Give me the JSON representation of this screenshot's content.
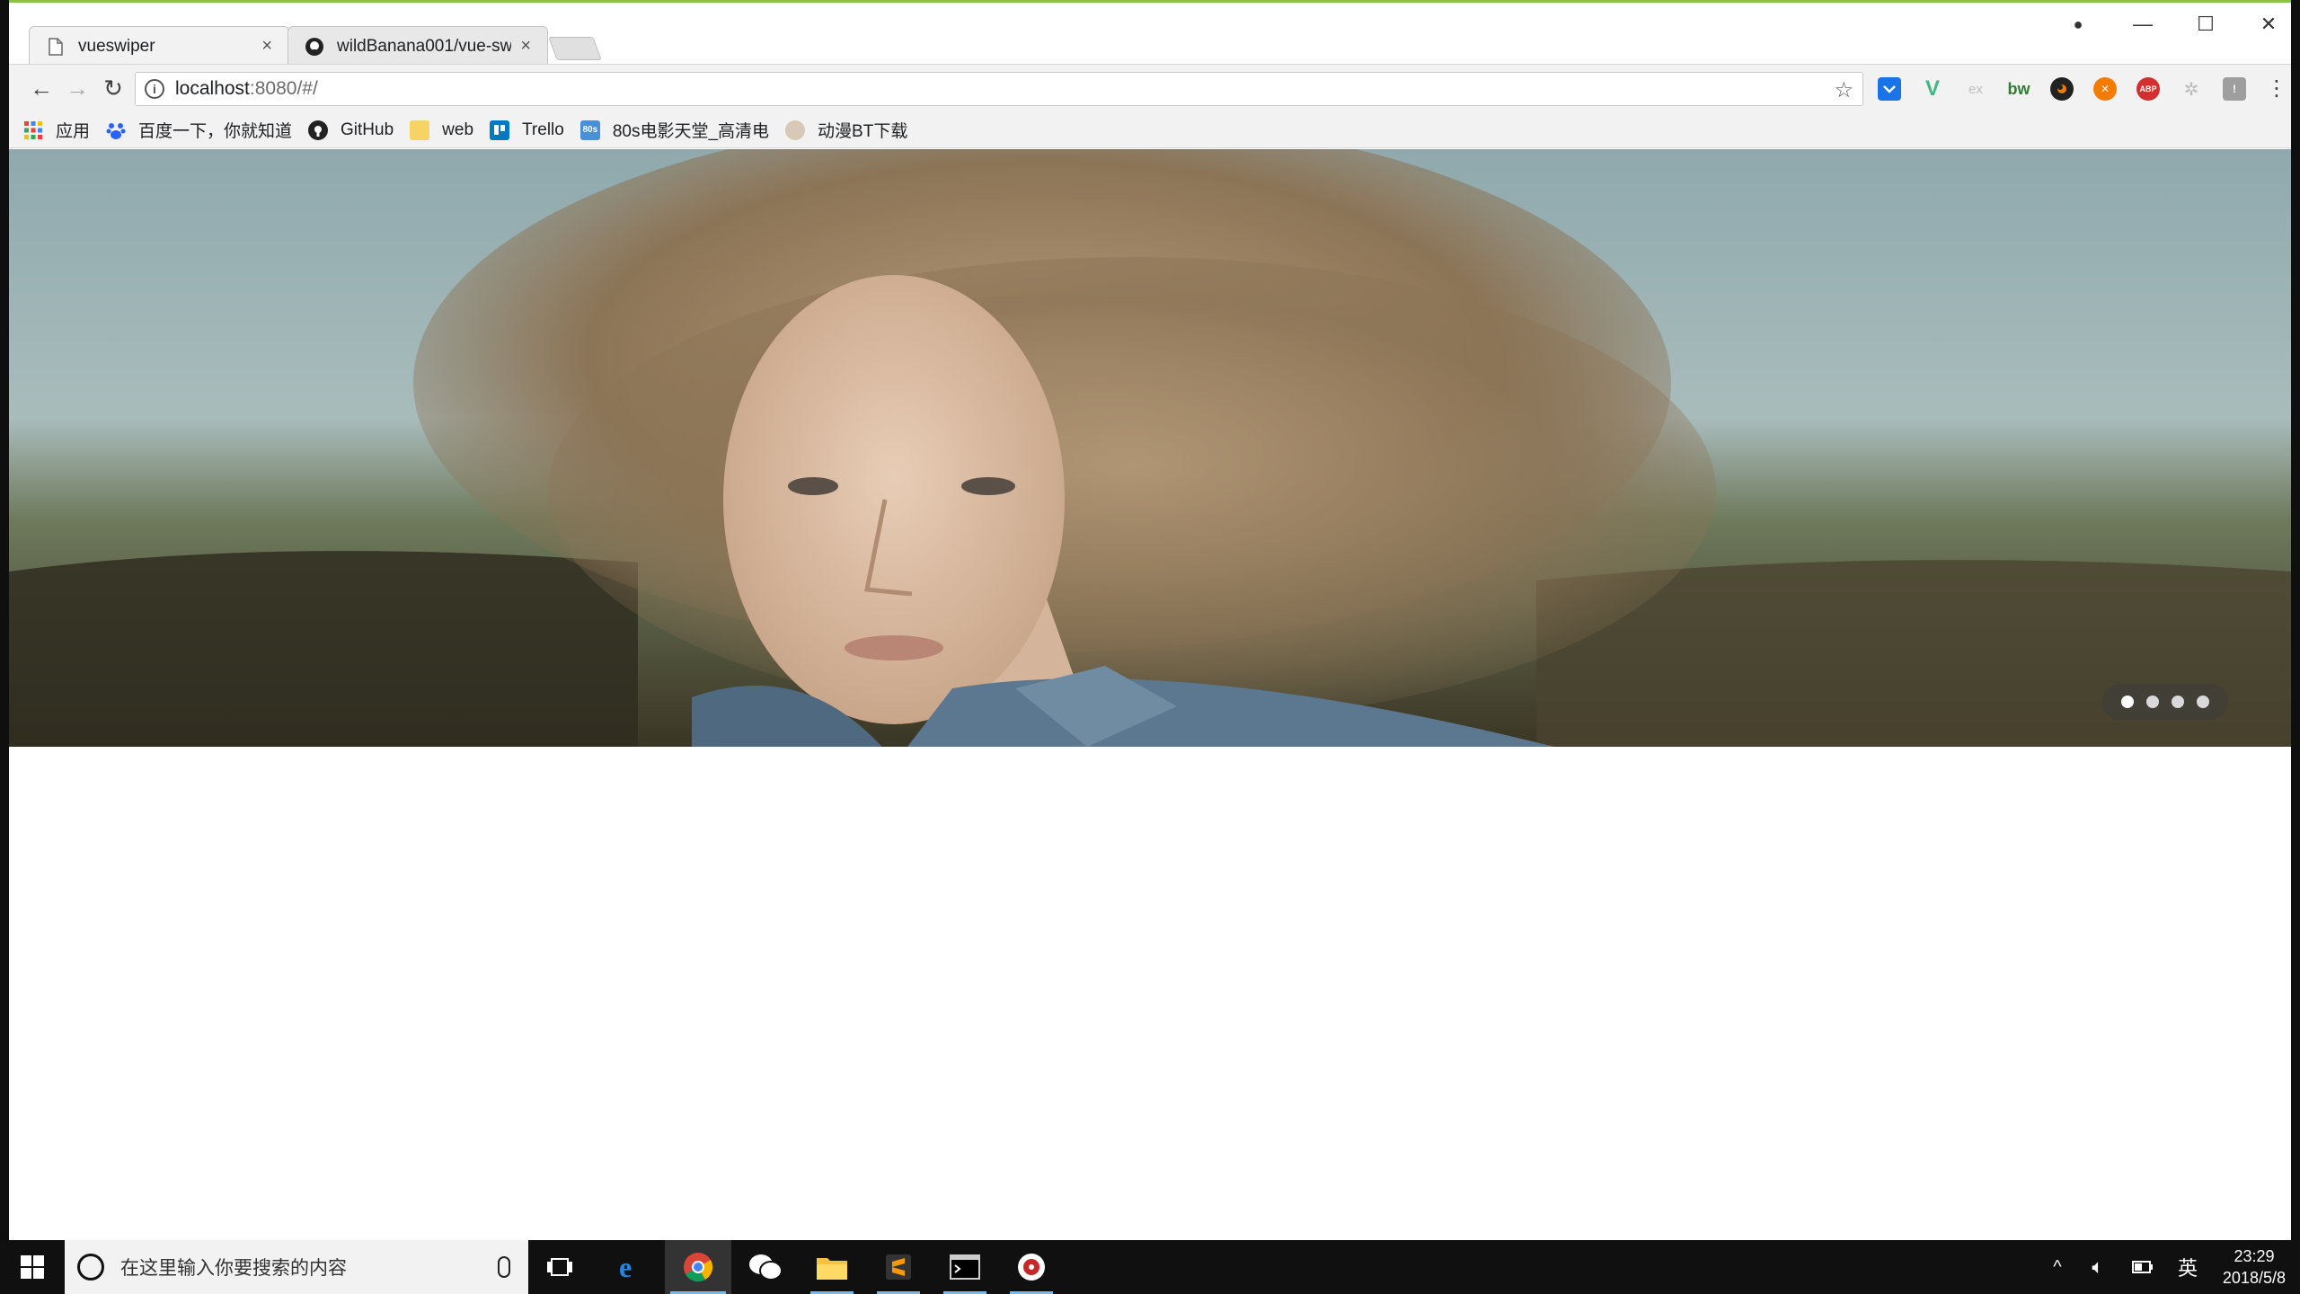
{
  "browser": {
    "tabs": [
      {
        "title": "vueswiper",
        "active": true
      },
      {
        "title": "wildBanana001/vue-sw",
        "active": false
      }
    ],
    "close_glyph": "×",
    "address": {
      "host": "localhost",
      "path": ":8080/#/"
    },
    "window_controls": {
      "profile": "●",
      "minimize": "—",
      "maximize": "☐",
      "close": "✕"
    },
    "nav": {
      "back": "←",
      "forward": "→",
      "reload": "↻",
      "star": "☆",
      "menu": "⋮"
    },
    "extensions": [
      {
        "icon": "pocket-icon",
        "label": "",
        "color": "#1a73e8"
      },
      {
        "icon": "vue-devtools-icon",
        "label": "V",
        "color": "#41b883"
      },
      {
        "icon": "ex-icon",
        "label": "ex",
        "color": "#cfcfcf"
      },
      {
        "icon": "bw-icon",
        "label": "bw",
        "color": "#2e7d32"
      },
      {
        "icon": "flame-icon",
        "label": "",
        "color": "#222"
      },
      {
        "icon": "orange-x-icon",
        "label": "✕",
        "color": "#f57c00"
      },
      {
        "icon": "adblock-icon",
        "label": "ABP",
        "color": "#d32f2f"
      },
      {
        "icon": "gear-ext-icon",
        "label": "✲",
        "color": "#c8c8c8"
      },
      {
        "icon": "shield-ext-icon",
        "label": "!",
        "color": "#9e9e9e"
      }
    ]
  },
  "bookmarks": [
    {
      "icon": "apps-icon",
      "label": "应用",
      "color": "#e53935"
    },
    {
      "icon": "baidu-icon",
      "label": "百度一下，你就知道",
      "color": "#2962ff"
    },
    {
      "icon": "github-icon",
      "label": "GitHub",
      "color": "#222"
    },
    {
      "icon": "folder-icon",
      "label": "web",
      "color": "#f6d365"
    },
    {
      "icon": "trello-icon",
      "label": "Trello",
      "color": "#0079bf"
    },
    {
      "icon": "80s-icon",
      "label": "80s电影天堂_高清电",
      "color": "#4a90d9"
    },
    {
      "icon": "anime-icon",
      "label": "动漫BT下载",
      "color": "#b0a090"
    }
  ],
  "swiper": {
    "slide_count": 4,
    "active_index": 0
  },
  "taskbar": {
    "search_placeholder": "在这里输入你要搜索的内容",
    "apps": [
      {
        "icon": "task-view-icon",
        "running": false
      },
      {
        "icon": "edge-icon",
        "running": false
      },
      {
        "icon": "chrome-icon",
        "running": true
      },
      {
        "icon": "wechat-icon",
        "running": false
      },
      {
        "icon": "file-explorer-icon",
        "running": true
      },
      {
        "icon": "sublime-icon",
        "running": true
      },
      {
        "icon": "terminal-icon",
        "running": true
      },
      {
        "icon": "media-player-icon",
        "running": true
      }
    ],
    "ime": "英",
    "time": "23:29",
    "date": "2018/5/8"
  }
}
